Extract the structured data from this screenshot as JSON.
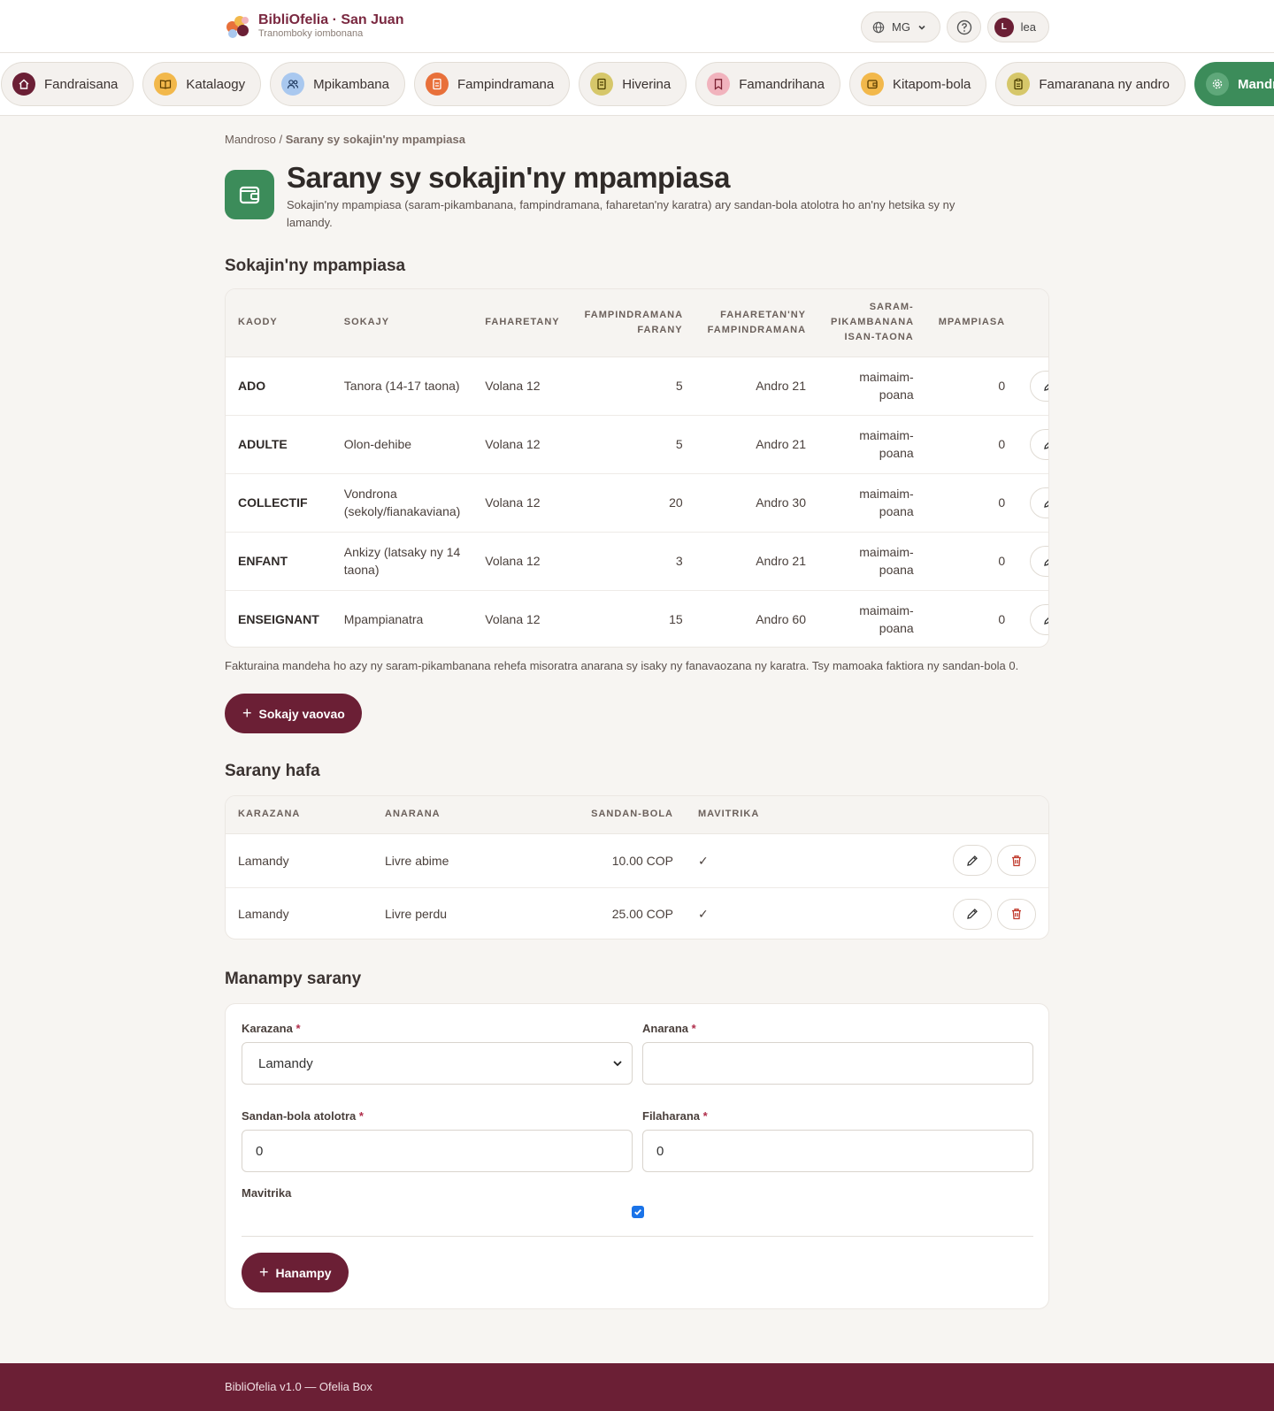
{
  "header": {
    "brand_title": "BibliOfelia · San Juan",
    "brand_subtitle": "Tranomboky iombonana",
    "language": "MG",
    "user_initial": "L",
    "user_name": "lea"
  },
  "nav": [
    {
      "label": "Fandraisana",
      "icon": "home-icon",
      "color": "#6b1f35"
    },
    {
      "label": "Katalaogy",
      "icon": "book-icon",
      "color": "#f2b84b"
    },
    {
      "label": "Mpikambana",
      "icon": "users-icon",
      "color": "#a9c8ef"
    },
    {
      "label": "Fampindramana",
      "icon": "loan-icon",
      "color": "#e8703a"
    },
    {
      "label": "Hiverina",
      "icon": "return-icon",
      "color": "#d6c76a"
    },
    {
      "label": "Famandrihana",
      "icon": "bookmark-icon",
      "color": "#f1b3bd"
    },
    {
      "label": "Kitapom-bola",
      "icon": "wallet-icon",
      "color": "#f2b84b"
    },
    {
      "label": "Famaranana ny andro",
      "icon": "clipboard-icon",
      "color": "#d6c76a"
    },
    {
      "label": "Mandroso",
      "icon": "gear-icon",
      "color": "#5fa87a"
    }
  ],
  "breadcrumb": {
    "parent": "Mandroso",
    "separator": "/",
    "current": "Sarany sy sokajin'ny mpampiasa"
  },
  "page": {
    "title": "Sarany sy sokajin'ny mpampiasa",
    "description": "Sokajin'ny mpampiasa (saram-pikambanana, fampindramana, faharetan'ny karatra) ary sandan-bola atolotra ho an'ny hetsika sy ny lamandy."
  },
  "categories": {
    "title": "Sokajin'ny mpampiasa",
    "headers": [
      "KAODY",
      "SOKAJY",
      "FAHARETANY",
      "FAMPINDRAMANA FARANY",
      "FAHARETAN'NY FAMPINDRAMANA",
      "SARAM-PIKAMBANANA ISAN-TAONA",
      "MPAMPIASA"
    ],
    "rows": [
      {
        "code": "ADO",
        "name": "Tanora (14-17 taona)",
        "duration": "Volana 12",
        "max_loans": "5",
        "loan_duration": "Andro 21",
        "fee_line1": "maimaim-",
        "fee_line2": "poana",
        "users": "0"
      },
      {
        "code": "ADULTE",
        "name": "Olon-dehibe",
        "duration": "Volana 12",
        "max_loans": "5",
        "loan_duration": "Andro 21",
        "fee_line1": "maimaim-",
        "fee_line2": "poana",
        "users": "0"
      },
      {
        "code": "COLLECTIF",
        "name": "Vondrona (sekoly/fianakaviana)",
        "duration": "Volana 12",
        "max_loans": "20",
        "loan_duration": "Andro 30",
        "fee_line1": "maimaim-",
        "fee_line2": "poana",
        "users": "0"
      },
      {
        "code": "ENFANT",
        "name": "Ankizy (latsaky ny 14 taona)",
        "duration": "Volana 12",
        "max_loans": "3",
        "loan_duration": "Andro 21",
        "fee_line1": "maimaim-",
        "fee_line2": "poana",
        "users": "0"
      },
      {
        "code": "ENSEIGNANT",
        "name": "Mpampianatra",
        "duration": "Volana 12",
        "max_loans": "15",
        "loan_duration": "Andro 60",
        "fee_line1": "maimaim-",
        "fee_line2": "poana",
        "users": "0"
      }
    ],
    "note": "Fakturaina mandeha ho azy ny saram-pikambanana rehefa misoratra anarana sy isaky ny fanavaozana ny karatra. Tsy mamoaka faktiora ny sandan-bola 0.",
    "add_button": "Sokajy vaovao"
  },
  "other_fees": {
    "title": "Sarany hafa",
    "headers": [
      "KARAZANA",
      "ANARANA",
      "SANDAN-BOLA",
      "MAVITRIKA"
    ],
    "rows": [
      {
        "type": "Lamandy",
        "name": "Livre abime",
        "amount": "10.00 COP",
        "active": "✓"
      },
      {
        "type": "Lamandy",
        "name": "Livre perdu",
        "amount": "25.00 COP",
        "active": "✓"
      }
    ]
  },
  "add_fee": {
    "title": "Manampy sarany",
    "type_label": "Karazana",
    "type_value": "Lamandy",
    "name_label": "Anarana",
    "name_value": "",
    "amount_label": "Sandan-bola atolotra",
    "amount_value": "0",
    "order_label": "Filaharana",
    "order_value": "0",
    "active_label": "Mavitrika",
    "active_checked": true,
    "required_mark": "*",
    "submit": "Hanampy"
  },
  "footer": {
    "text": "BibliOfelia v1.0 — Ofelia Box"
  },
  "colors": {
    "brand": "#6b1f35",
    "accent_green": "#3c8c5a",
    "danger": "#c0392b"
  }
}
